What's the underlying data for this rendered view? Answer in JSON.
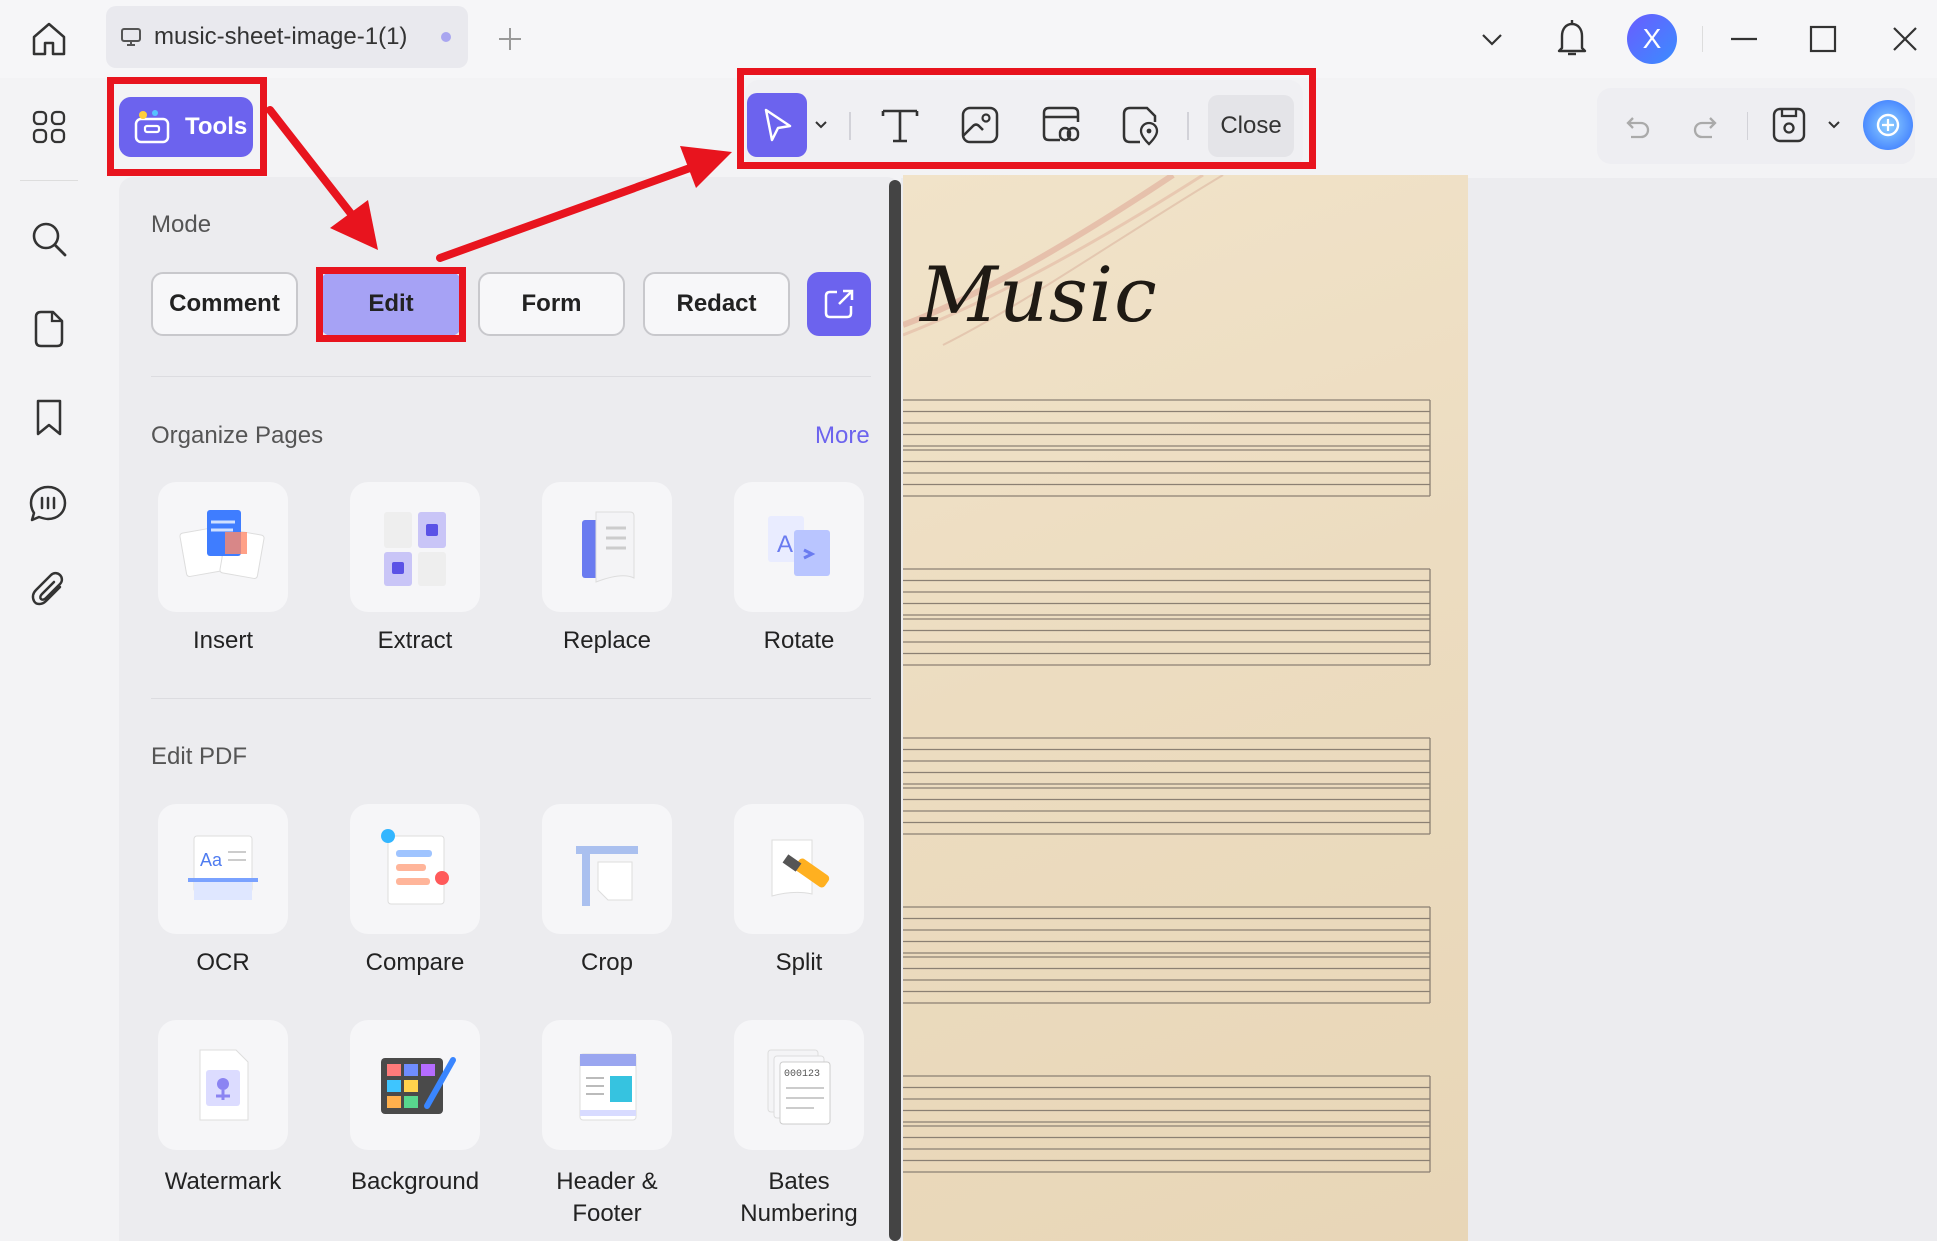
{
  "titlebar": {
    "tab_title": "music-sheet-image-1(1)",
    "avatar_letter": "X",
    "icons": [
      "home-icon",
      "monitor-icon",
      "add-tab-icon",
      "chevron-down-icon",
      "bell-icon",
      "minimize-icon",
      "maximize-icon",
      "close-window-icon"
    ]
  },
  "sidebar": {
    "icons": [
      "thumbnails-icon",
      "search-icon",
      "page-icon",
      "bookmark-icon",
      "comments-icon",
      "attachment-icon"
    ]
  },
  "toolbar": {
    "tools_label": "Tools",
    "close_label": "Close",
    "tool_icons": [
      "select-arrow-icon",
      "text-icon",
      "image-icon",
      "link-icon",
      "location-icon"
    ]
  },
  "right_toolbar": {
    "icons": [
      "undo-icon",
      "redo-icon",
      "save-icon",
      "chevron-down-icon",
      "ai-assistant-icon"
    ]
  },
  "panel": {
    "mode": {
      "title": "Mode",
      "buttons": [
        "Comment",
        "Edit",
        "Form",
        "Redact"
      ],
      "selected": "Edit"
    },
    "organize": {
      "title": "Organize Pages",
      "more": "More",
      "items": [
        "Insert",
        "Extract",
        "Replace",
        "Rotate"
      ]
    },
    "edit_pdf": {
      "title": "Edit PDF",
      "items": [
        "OCR",
        "Compare",
        "Crop",
        "Split"
      ],
      "items2": [
        [
          "Watermark"
        ],
        [
          "Background"
        ],
        [
          "Header &",
          "Footer"
        ],
        [
          "Bates",
          "Numbering"
        ]
      ]
    }
  },
  "document": {
    "title": "Music",
    "staves": 5
  },
  "colors": {
    "accent": "#6c63ee",
    "annotation_red": "#e8141e",
    "paper": "#ecdcc0"
  }
}
